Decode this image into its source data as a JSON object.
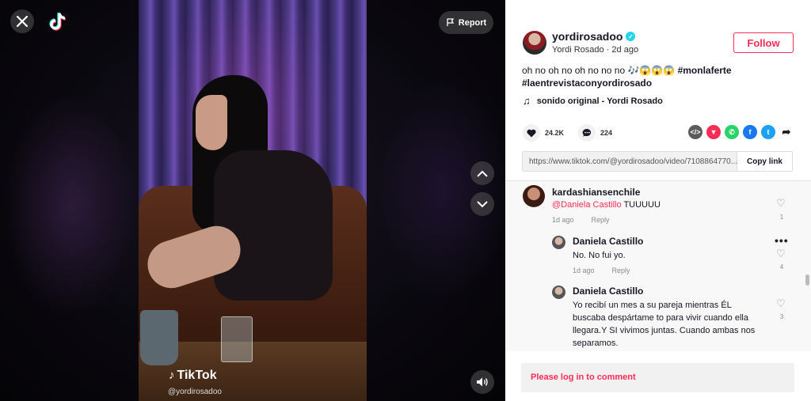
{
  "video": {
    "close_icon": "close-icon",
    "report_label": "Report",
    "watermark_brand": "TikTok",
    "watermark_user": "@yordirosadoo"
  },
  "author": {
    "username": "yordirosadoo",
    "display_name_date": "Yordi Rosado · 2d ago",
    "follow_label": "Follow"
  },
  "caption": {
    "text": "oh no oh no oh no no no 🎶😱😱😱",
    "hashtags": [
      "#monlaferte",
      "#laentrevistaconyordirosado"
    ]
  },
  "music": {
    "label": "sonido original - Yordi Rosado"
  },
  "stats": {
    "likes": "24.2K",
    "comments": "224"
  },
  "share": {
    "icons": [
      "embed-icon",
      "send-icon",
      "whatsapp-icon",
      "facebook-icon",
      "twitter-icon",
      "share-arrow-icon"
    ]
  },
  "link": {
    "url": "https://www.tiktok.com/@yordirosadoo/video/7108864770...",
    "copy_label": "Copy link"
  },
  "comments": [
    {
      "username": "kardashiansenchile",
      "mention": "@Daniela Castillo",
      "text": " TUUUUU",
      "age": "1d ago",
      "reply_label": "Reply",
      "likes": "1"
    },
    {
      "username": "Daniela Castillo",
      "text": "No. No fui yo.",
      "age": "1d ago",
      "reply_label": "Reply",
      "likes": "4"
    },
    {
      "username": "Daniela Castillo",
      "text_lines": [
        "Yo recibí un mes a su pareja mientras ÉL",
        "buscaba despártame to para vivir cuando ella",
        "llegara.Y SI vivimos juntas. Cuando ambas nos",
        "separamos."
      ],
      "likes": "3"
    }
  ],
  "login_prompt": "Please log in to comment",
  "colors": {
    "accent": "#fe2c55",
    "verified": "#20d5ec"
  }
}
